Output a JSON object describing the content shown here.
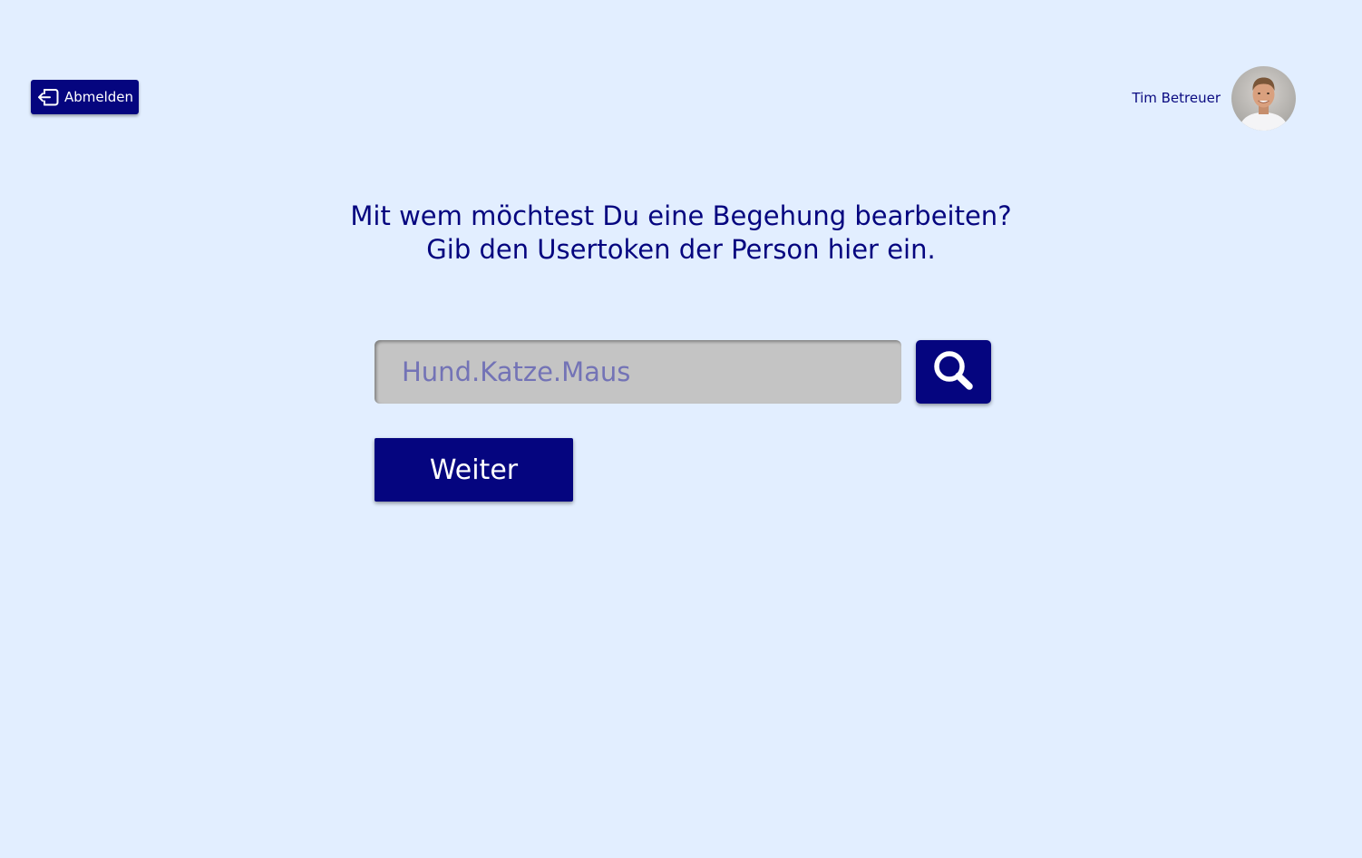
{
  "header": {
    "logout_label": "Abmelden",
    "user_name": "Tim Betreuer"
  },
  "main": {
    "question_line1": "Mit wem möchtest Du eine Begehung bearbeiten?",
    "question_line2": "Gib den Usertoken der Person hier ein.",
    "token_input": {
      "value": "",
      "placeholder": "Hund.Katze.Maus"
    },
    "next_label": "Weiter"
  },
  "icons": {
    "logout": "logout-icon",
    "search": "search-icon",
    "avatar": "user-avatar"
  },
  "colors": {
    "background": "#e2eeff",
    "primary": "#05057f",
    "input_bg": "#c4c4c4",
    "placeholder": "#7373b6"
  }
}
